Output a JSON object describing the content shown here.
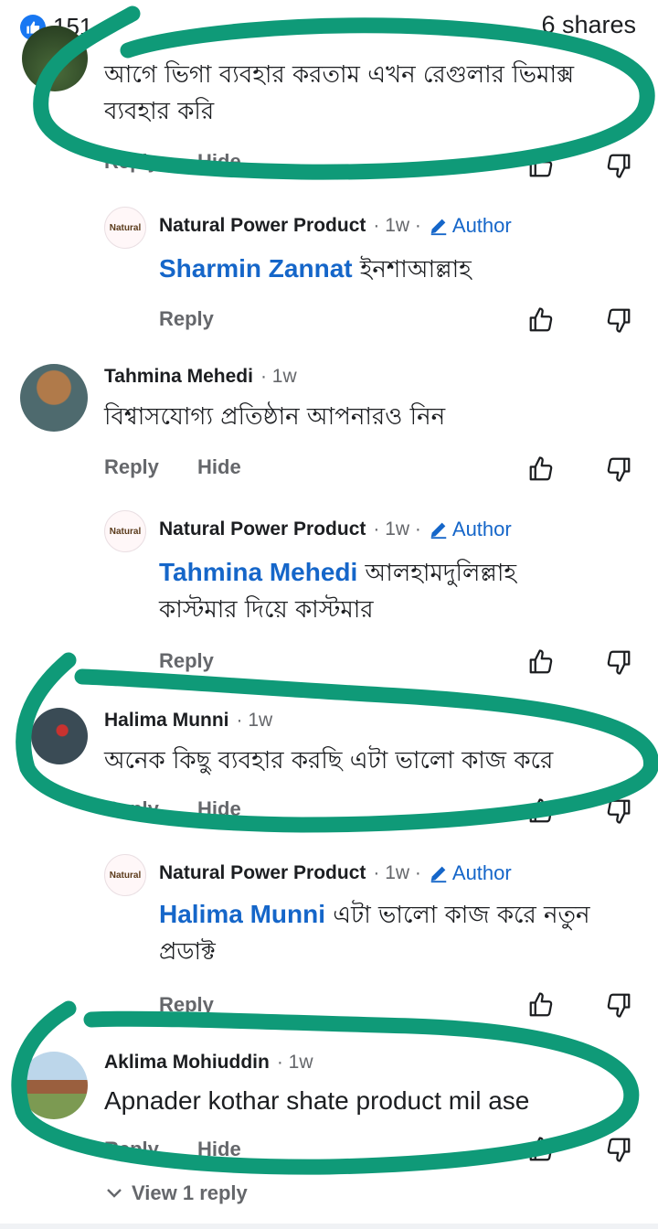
{
  "header": {
    "likes": "151",
    "shares": "6 shares"
  },
  "comments": [
    {
      "text": "আগে ভিগা ব্যবহার করতাম এখন রেগুলার ভিমাক্স ব্যবহার করি",
      "reply": "Reply",
      "hide": "Hide"
    },
    {
      "name": "Natural Power Product",
      "time": "· 1w ·",
      "author": "Author",
      "mention": "Sharmin Zannat",
      "text": " ইনশাআল্লাহ",
      "reply": "Reply"
    },
    {
      "name": "Tahmina Mehedi",
      "time": "· 1w",
      "text": "বিশ্বাসযোগ্য প্রতিষ্ঠান আপনারও নিন",
      "reply": "Reply",
      "hide": "Hide"
    },
    {
      "name": "Natural Power Product",
      "time": "· 1w ·",
      "author": "Author",
      "mention": "Tahmina Mehedi",
      "text": " আলহামদুলিল্লাহ কাস্টমার দিয়ে কাস্টমার",
      "reply": "Reply"
    },
    {
      "name": "Halima Munni",
      "time": "· 1w",
      "text": "অনেক কিছু ব্যবহার করছি এটা ভালো কাজ করে",
      "reply": "Reply",
      "hide": "Hide"
    },
    {
      "name": "Natural Power Product",
      "time": "· 1w ·",
      "author": "Author",
      "mention": "Halima Munni",
      "text": " এটা ভালো কাজ করে নতুন প্রডাক্ট",
      "reply": "Reply"
    },
    {
      "name": "Aklima Mohiuddin",
      "time": "· 1w",
      "text": "Apnader kothar shate product mil ase",
      "reply": "Reply",
      "hide": "Hide"
    }
  ],
  "view_replies": "View 1 reply",
  "logo_text": "Natural",
  "icons": {
    "like": "thumbs-up-icon",
    "dislike": "thumbs-down-icon",
    "edit": "pencil-icon",
    "chevron": "chevron-down-icon"
  },
  "colors": {
    "mention": "#1566c9",
    "annotation": "#0f9a78",
    "like_badge": "#1877f2"
  }
}
